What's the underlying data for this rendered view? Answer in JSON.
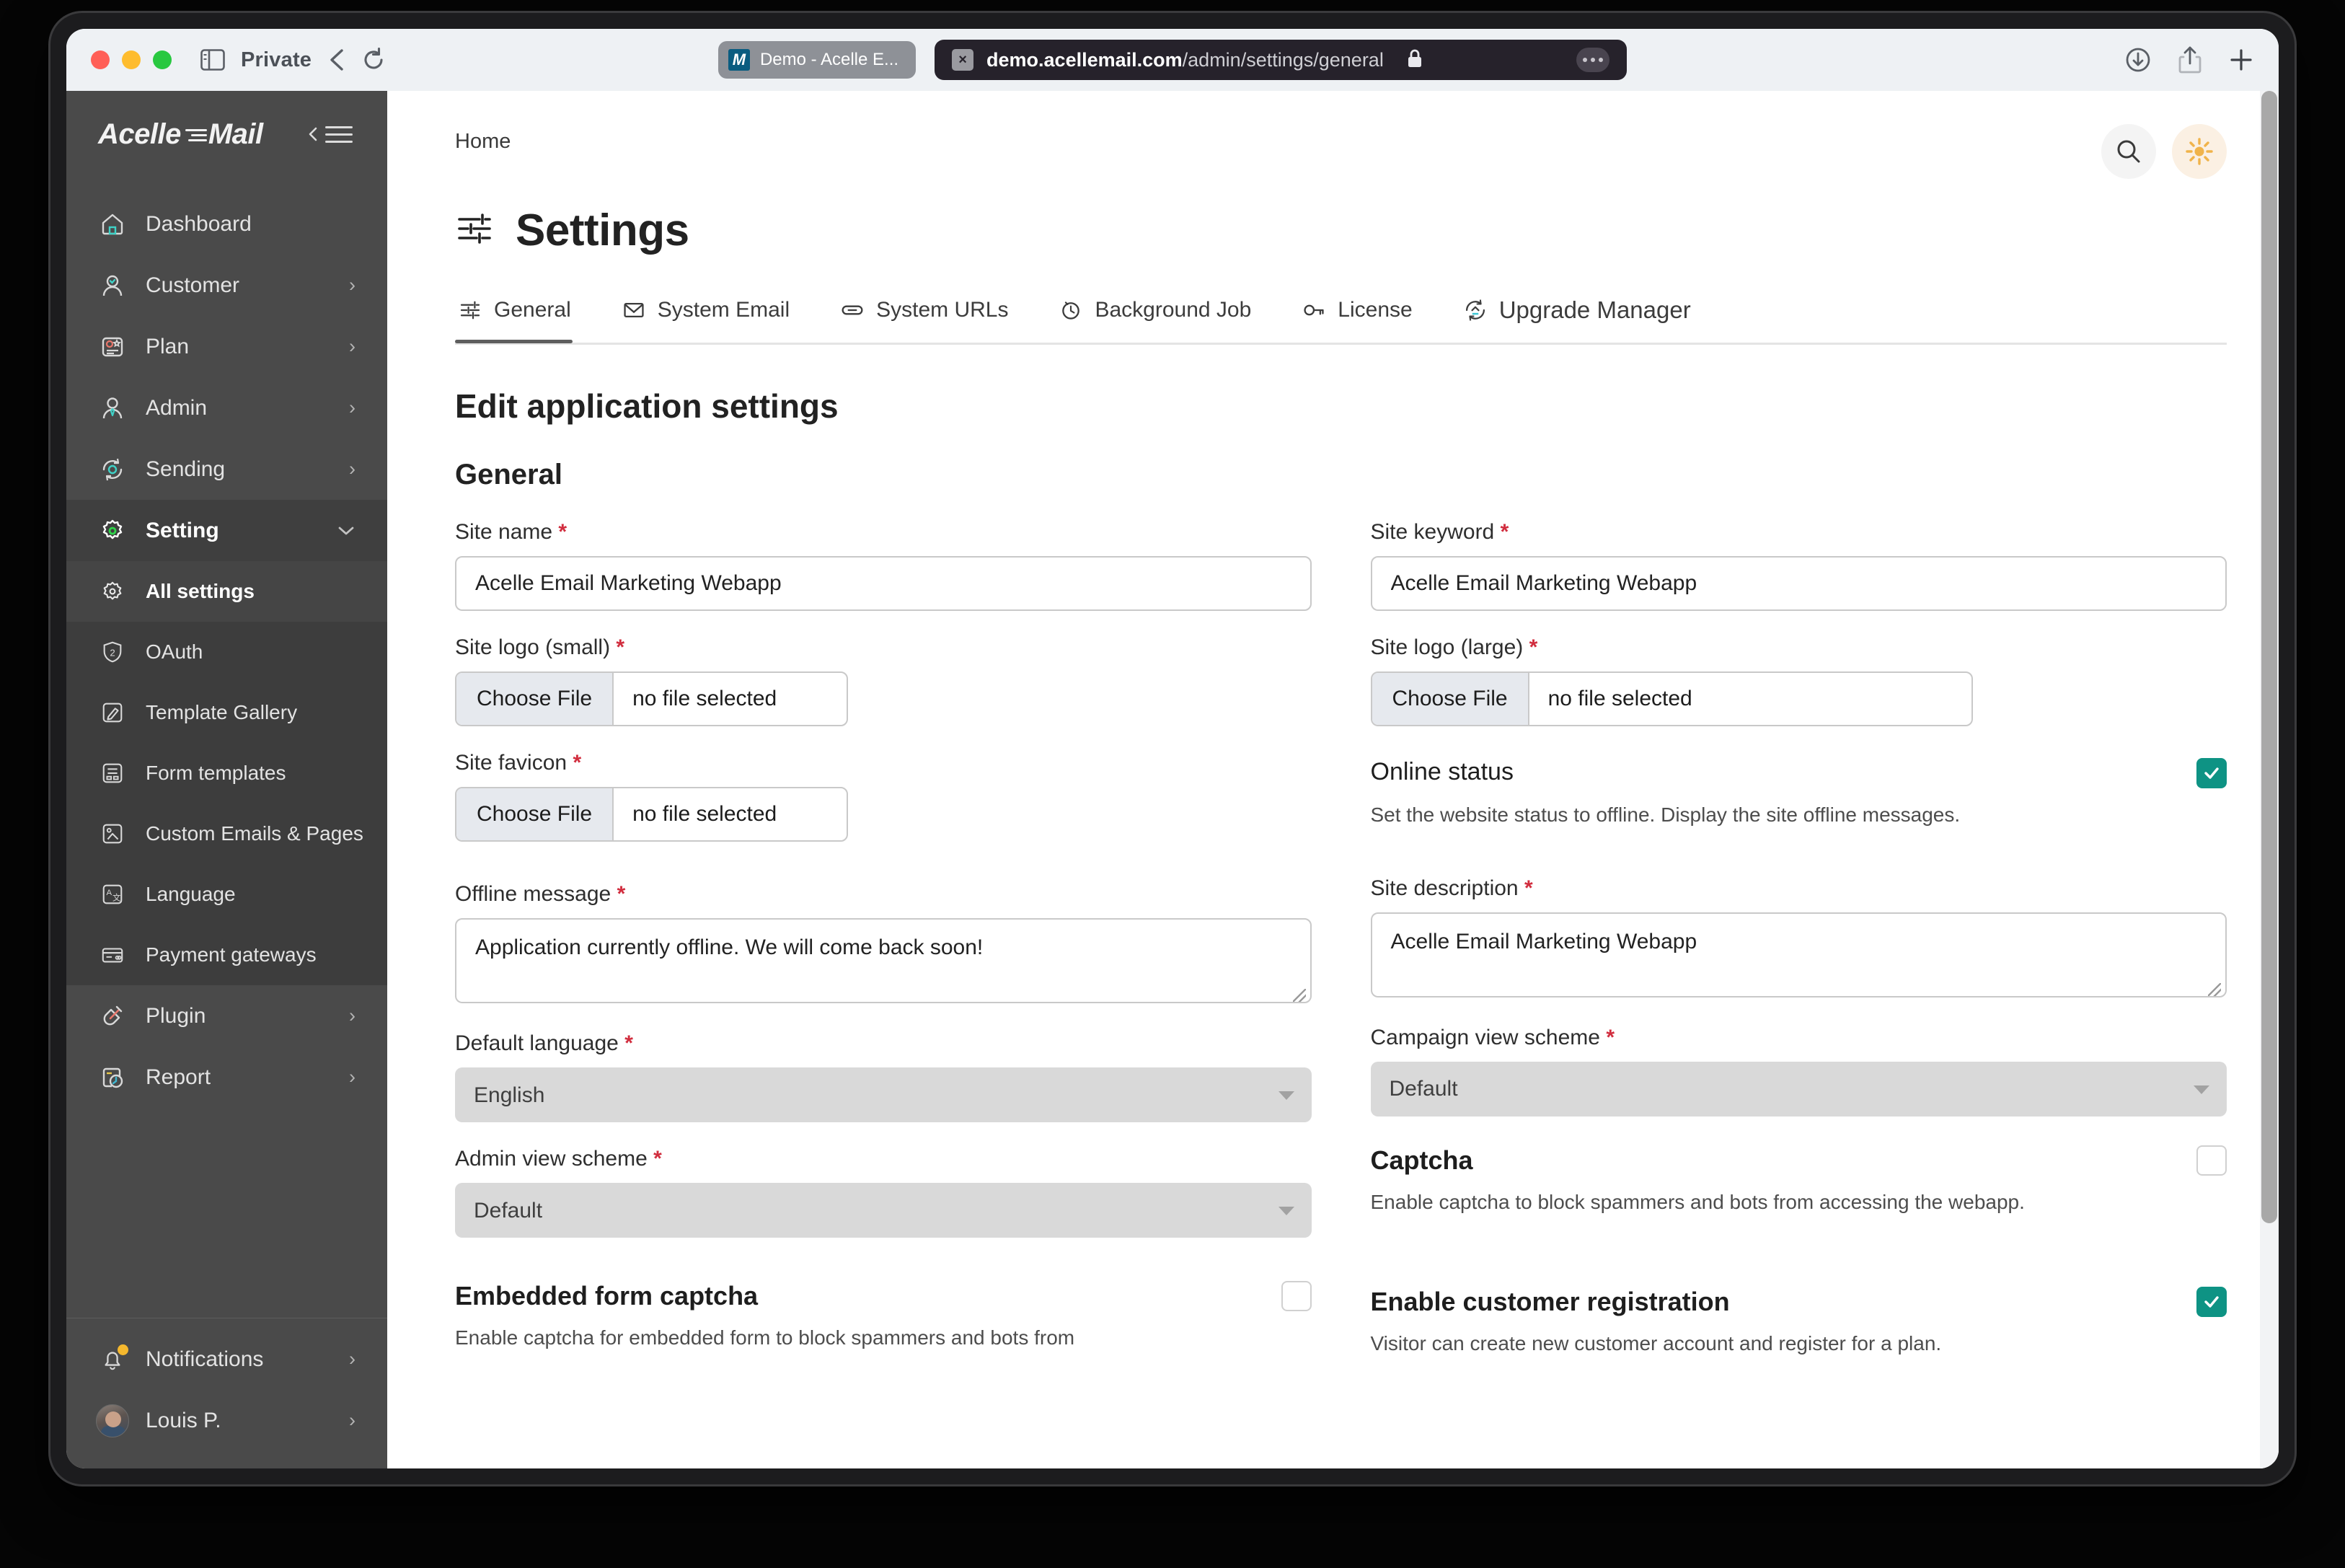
{
  "browser": {
    "private_label": "Private",
    "tab": {
      "title": "Demo - Acelle E...",
      "favicon_letter": "M"
    },
    "url": {
      "domain": "demo.acellemail.com",
      "path": "/admin/settings/general"
    }
  },
  "sidebar": {
    "brand": "Acelle Mail",
    "items": [
      {
        "label": "Dashboard",
        "icon": "home-icon",
        "chevron": ""
      },
      {
        "label": "Customer",
        "icon": "user-icon",
        "chevron": "›"
      },
      {
        "label": "Plan",
        "icon": "plan-icon",
        "chevron": "›"
      },
      {
        "label": "Admin",
        "icon": "admin-icon",
        "chevron": "›"
      },
      {
        "label": "Sending",
        "icon": "sending-icon",
        "chevron": "›"
      },
      {
        "label": "Setting",
        "icon": "gear-icon",
        "chevron": "⌄"
      }
    ],
    "submenu": [
      {
        "label": "All settings",
        "icon": "gear-settings-icon"
      },
      {
        "label": "OAuth",
        "icon": "shield-2-icon"
      },
      {
        "label": "Template Gallery",
        "icon": "brush-icon"
      },
      {
        "label": "Form templates",
        "icon": "form-icon"
      },
      {
        "label": "Custom Emails & Pages",
        "icon": "image-page-icon"
      },
      {
        "label": "Language",
        "icon": "translate-icon"
      },
      {
        "label": "Payment gateways",
        "icon": "credit-card-icon"
      }
    ],
    "items_after": [
      {
        "label": "Plugin",
        "icon": "plug-icon",
        "chevron": "›"
      },
      {
        "label": "Report",
        "icon": "report-clock-icon",
        "chevron": "›"
      }
    ],
    "bottom": [
      {
        "label": "Notifications",
        "icon": "bell-icon",
        "chevron": "›",
        "badge": true
      },
      {
        "label": "Louis P.",
        "icon": "avatar",
        "chevron": "›"
      }
    ]
  },
  "header": {
    "breadcrumb": "Home",
    "title": "Settings",
    "search_icon": "search-icon",
    "theme_icon": "sun-icon"
  },
  "tabs": [
    {
      "label": "General",
      "icon": "sliders-icon",
      "active": true
    },
    {
      "label": "System Email",
      "icon": "envelope-icon",
      "active": false
    },
    {
      "label": "System URLs",
      "icon": "link-icon",
      "active": false
    },
    {
      "label": "Background Job",
      "icon": "clock-icon",
      "active": false
    },
    {
      "label": "License",
      "icon": "key-icon",
      "active": false
    },
    {
      "label": "Upgrade Manager",
      "icon": "upgrade-icon",
      "active": false
    }
  ],
  "form": {
    "page_heading": "Edit application settings",
    "section_heading": "General",
    "required_mark": "*",
    "file_button_label": "Choose File",
    "file_empty_label": "no file selected",
    "fields": {
      "site_name": {
        "label": "Site name",
        "value": "Acelle Email Marketing Webapp"
      },
      "site_keyword": {
        "label": "Site keyword",
        "value": "Acelle Email Marketing Webapp"
      },
      "site_logo_small": {
        "label": "Site logo (small)"
      },
      "site_logo_large": {
        "label": "Site logo (large)"
      },
      "site_favicon": {
        "label": "Site favicon"
      },
      "online_status": {
        "label": "Online status",
        "description": "Set the website status to offline. Display the site offline messages.",
        "checked": true
      },
      "offline_message": {
        "label": "Offline message",
        "value": "Application currently offline. We will come back soon!"
      },
      "site_description": {
        "label": "Site description",
        "value": "Acelle Email Marketing Webapp"
      },
      "default_language": {
        "label": "Default language",
        "value": "English"
      },
      "campaign_view_scheme": {
        "label": "Campaign view scheme",
        "value": "Default"
      },
      "admin_view_scheme": {
        "label": "Admin view scheme",
        "value": "Default"
      },
      "captcha": {
        "label": "Captcha",
        "description": "Enable captcha to block spammers and bots from accessing the webapp.",
        "checked": false
      },
      "embedded_form_captcha": {
        "label": "Embedded form captcha",
        "description": "Enable captcha for embedded form to block spammers and bots from",
        "checked": false
      },
      "enable_customer_registration": {
        "label": "Enable customer registration",
        "description": "Visitor can create new customer account and register for a plan.",
        "checked": true
      }
    }
  },
  "colors": {
    "accent_teal": "#0e9384",
    "sidebar_bg": "#4a4a4a",
    "required_red": "#d12d3e",
    "sun_yellow": "#f0b34a"
  }
}
